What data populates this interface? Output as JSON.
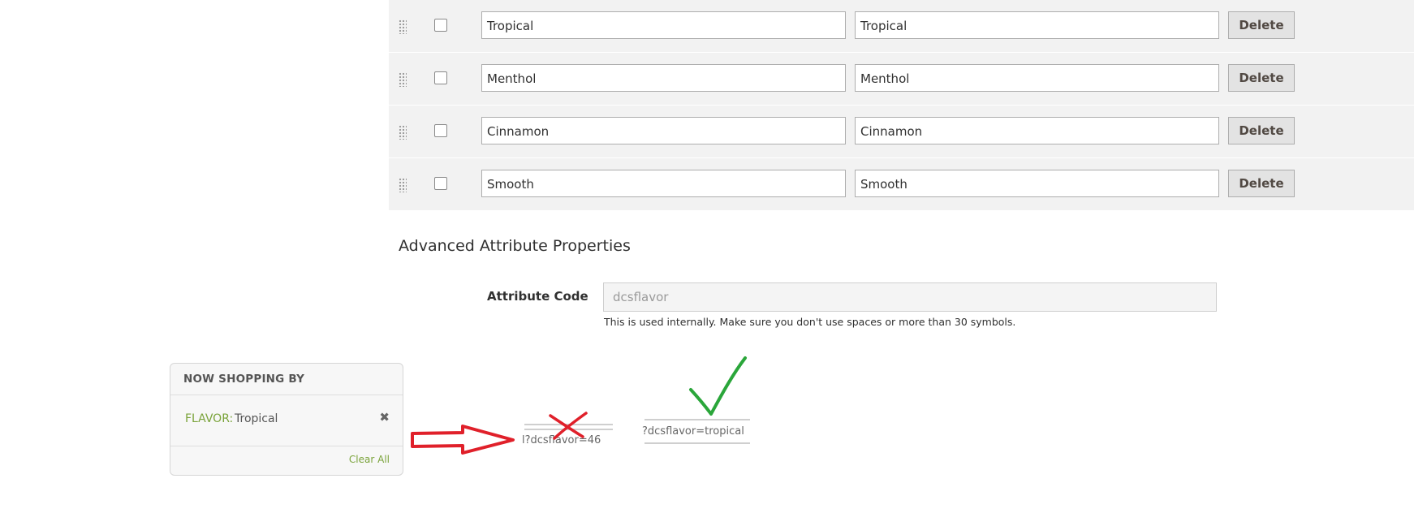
{
  "options": [
    {
      "admin": "Tropical",
      "store": "Tropical",
      "delete_label": "Delete"
    },
    {
      "admin": "Menthol",
      "store": "Menthol",
      "delete_label": "Delete"
    },
    {
      "admin": "Cinnamon",
      "store": "Cinnamon",
      "delete_label": "Delete"
    },
    {
      "admin": "Smooth",
      "store": "Smooth",
      "delete_label": "Delete"
    }
  ],
  "advanced": {
    "title": "Advanced Attribute Properties",
    "attribute_code_label": "Attribute Code",
    "attribute_code_value": "dcsflavor",
    "attribute_code_note": "This is used internally. Make sure you don't use spaces or more than 30 symbols."
  },
  "now_shopping_by": {
    "heading": "NOW SHOPPING BY",
    "filter_label": "FLAVOR:",
    "filter_value": "Tropical",
    "remove_glyph": "✖",
    "clear_all": "Clear All"
  },
  "annotations": {
    "bad_url": "l?dcsflavor=46",
    "good_url": "?dcsflavor=tropical",
    "arrow_color": "#e0202a",
    "cross_color": "#e0202a",
    "check_color": "#2aa63a"
  },
  "colors": {
    "row_bg": "#f2f2f2",
    "accent_green": "#7aa33a",
    "button_bg": "#e3e3e3"
  }
}
